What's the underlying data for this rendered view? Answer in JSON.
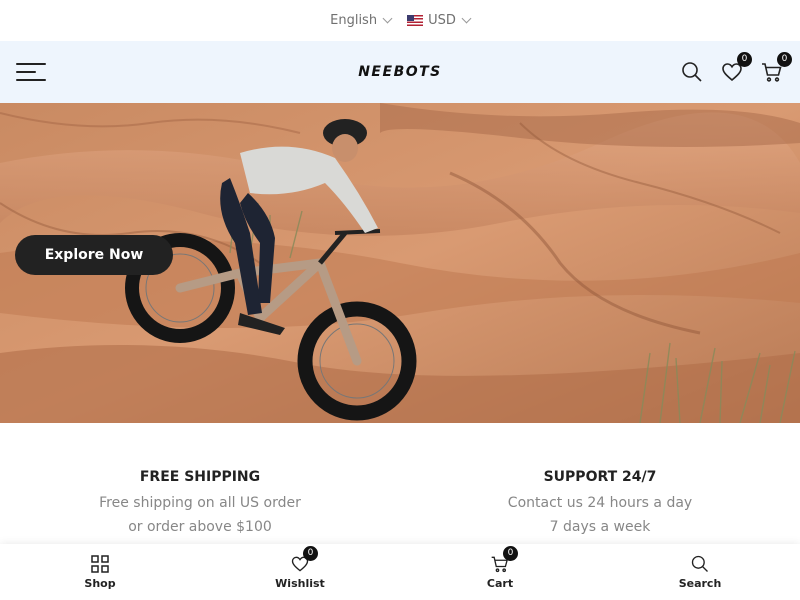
{
  "topbar": {
    "language": "English",
    "currency": "USD"
  },
  "header": {
    "logo": "NEEBOTS",
    "wishlist_count": "0",
    "cart_count": "0"
  },
  "hero": {
    "cta_label": "Explore Now"
  },
  "features": [
    {
      "title": "FREE SHIPPING",
      "line1": "Free shipping on all US order",
      "line2": "or order above $100"
    },
    {
      "title": "SUPPORT 24/7",
      "line1": "Contact us 24 hours a day",
      "line2": "7 days a week"
    }
  ],
  "bottom_nav": {
    "items": [
      {
        "label": "Shop"
      },
      {
        "label": "Wishlist",
        "count": "0"
      },
      {
        "label": "Cart",
        "count": "0"
      },
      {
        "label": "Search"
      }
    ]
  },
  "colors": {
    "header_bg": "#eef5fd",
    "button_bg": "#222222",
    "badge_bg": "#111111",
    "muted_text": "#878787"
  }
}
